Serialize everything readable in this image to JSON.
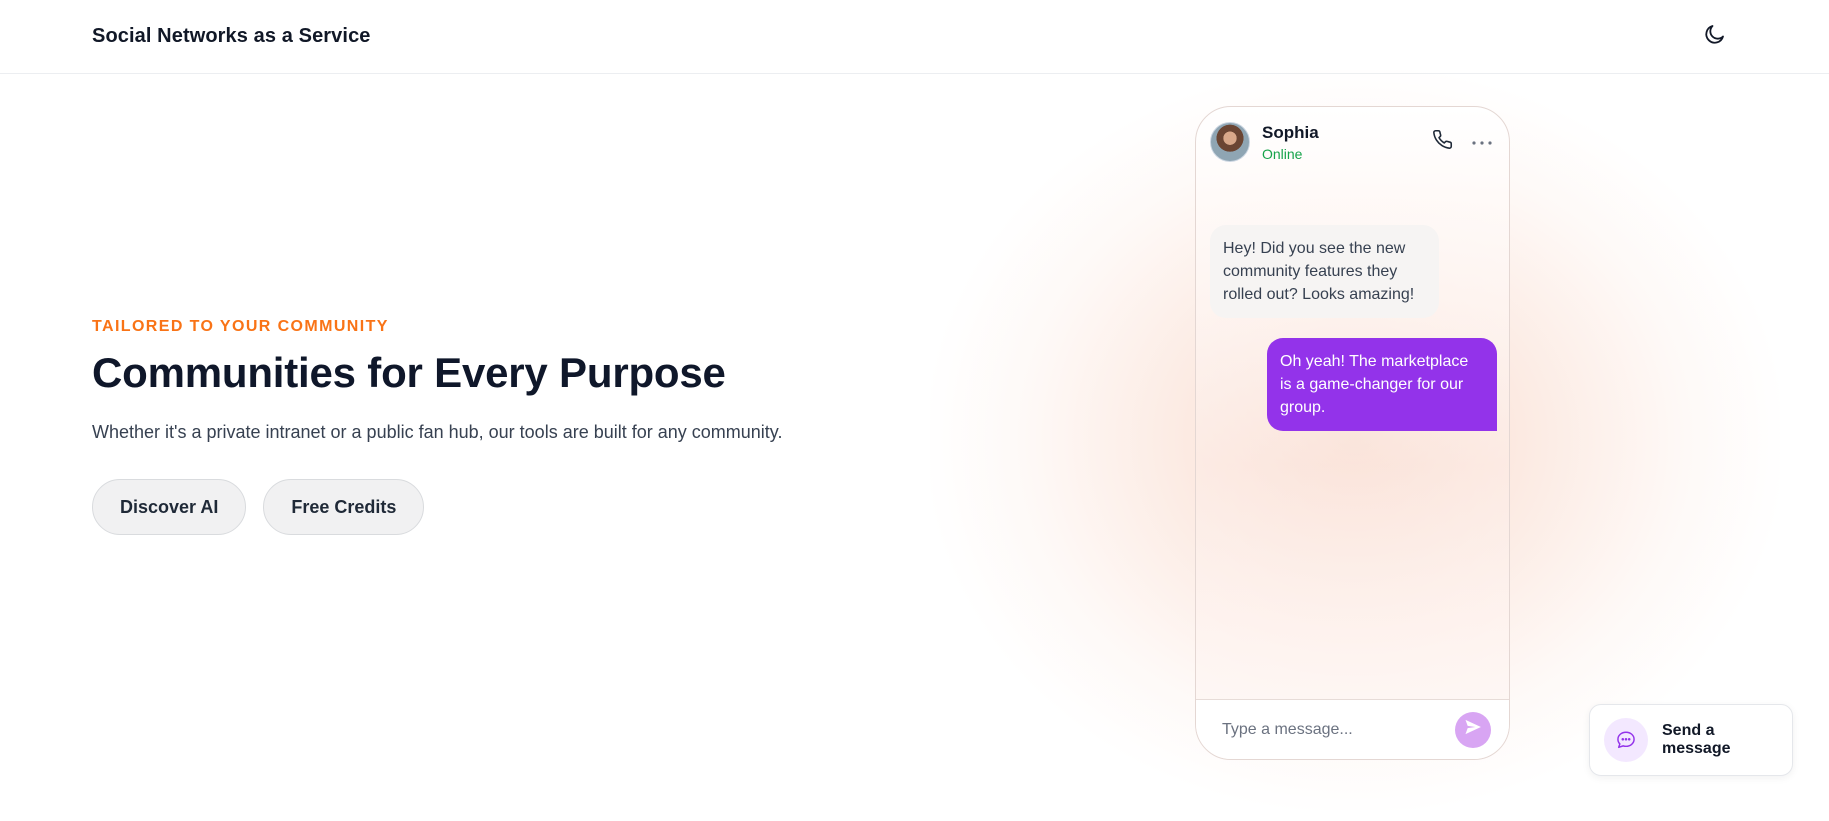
{
  "header": {
    "brand": "Social Networks as a Service",
    "theme_icon": "moon-icon"
  },
  "hero": {
    "eyebrow": "TAILORED TO YOUR COMMUNITY",
    "title": "Communities for Every Purpose",
    "subtitle": "Whether it's a private intranet or a public fan hub, our tools are built for any community.",
    "buttons": [
      {
        "label": "Discover AI"
      },
      {
        "label": "Free Credits"
      }
    ]
  },
  "chat": {
    "contact": {
      "name": "Sophia",
      "status": "Online"
    },
    "icons": [
      "phone-icon",
      "more-icon"
    ],
    "messages": [
      {
        "direction": "incoming",
        "text": "Hey! Did you see the new community features they rolled out? Looks amazing!"
      },
      {
        "direction": "outgoing",
        "text": "Oh yeah! The marketplace is a game-changer for our group."
      }
    ],
    "composer": {
      "placeholder": "Type a message...",
      "send_icon": "send-icon"
    }
  },
  "widget": {
    "label": "Send a message",
    "icon": "chat-bubble-icon"
  },
  "colors": {
    "accent": "#9333ea",
    "eyebrow": "#f97316",
    "online": "#16a34a",
    "send_button": "#d8a5f3"
  }
}
